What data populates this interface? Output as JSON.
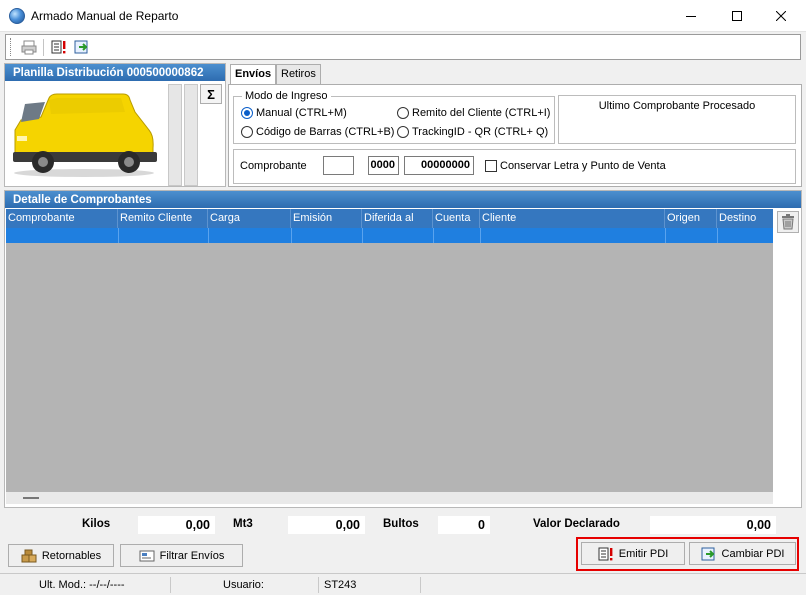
{
  "window": {
    "title": "Armado Manual de Reparto",
    "icon": "globe-icon"
  },
  "toolbar": {
    "icons": [
      "printer-icon",
      "document-alert-icon",
      "export-icon"
    ]
  },
  "planilla": {
    "header": "Planilla Distribución 000500000862",
    "image": "yellow-van-icon",
    "sum_button": "Σ"
  },
  "tabs": [
    {
      "label": "Envíos",
      "active": true
    },
    {
      "label": "Retiros",
      "active": false
    }
  ],
  "modo_ingreso": {
    "legend": "Modo de Ingreso",
    "options": [
      {
        "label": "Manual (CTRL+M)",
        "selected": true
      },
      {
        "label": "Remito del Cliente (CTRL+I)",
        "selected": false
      },
      {
        "label": "Código de Barras (CTRL+B)",
        "selected": false
      },
      {
        "label": "TrackingID - QR (CTRL+ Q)",
        "selected": false
      }
    ]
  },
  "ultimo": {
    "label": "Ultimo Comprobante Procesado"
  },
  "comprobante": {
    "label": "Comprobante",
    "letra": "",
    "punto_venta": "0000",
    "numero": "00000000",
    "conservar_label": "Conservar Letra y Punto de Venta",
    "conservar_checked": false
  },
  "detalle": {
    "header": "Detalle de Comprobantes",
    "columns": [
      "Comprobante",
      "Remito Cliente",
      "Carga",
      "Emisión",
      "Diferida al",
      "Cuenta",
      "Cliente",
      "Origen",
      "Destino"
    ],
    "rows": []
  },
  "totals": {
    "kilos_label": "Kilos",
    "kilos": "0,00",
    "mt3_label": "Mt3",
    "mt3": "0,00",
    "bultos_label": "Bultos",
    "bultos": "0",
    "valor_label": "Valor Declarado",
    "valor": "0,00"
  },
  "buttons": {
    "retornables": "Retornables",
    "filtrar": "Filtrar Envíos",
    "emitir": "Emitir PDI",
    "cambiar": "Cambiar PDI"
  },
  "status": {
    "ult_mod": "Ult. Mod.: --/--/----",
    "usuario_label": "Usuario:",
    "usuario": "ST243"
  },
  "colors": {
    "header_blue": "#2d6cb0",
    "selection_blue": "#1f7fe0",
    "highlight_red": "#e60000",
    "van_yellow": "#f5d400"
  }
}
